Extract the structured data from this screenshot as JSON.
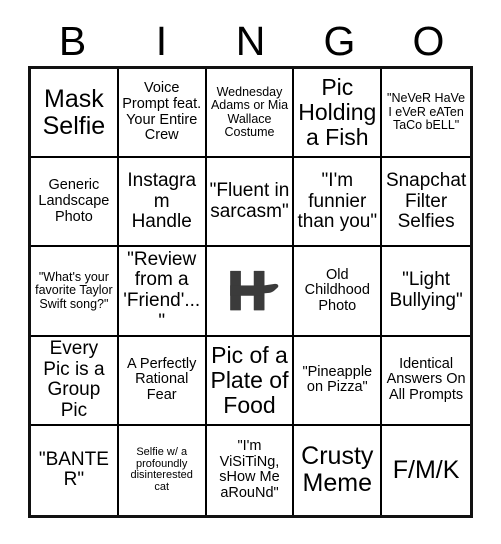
{
  "card": {
    "header_letters": [
      "B",
      "I",
      "N",
      "G",
      "O"
    ],
    "rows": [
      [
        {
          "text": "Mask Selfie",
          "size": "xl"
        },
        {
          "text": "Voice Prompt feat. Your Entire Crew",
          "size": "sm"
        },
        {
          "text": "Wednesday Adams or Mia Wallace Costume",
          "size": "xs"
        },
        {
          "text": "Pic Holding a Fish",
          "size": "lg"
        },
        {
          "text": "\"NeVeR HaVe I eVeR eATen TaCo bELL\"",
          "size": "xs"
        }
      ],
      [
        {
          "text": "Generic Landscape Photo",
          "size": "sm"
        },
        {
          "text": "Instagram Handle",
          "size": "md"
        },
        {
          "text": "\"Fluent in sarcasm\"",
          "size": "md"
        },
        {
          "text": "\"I'm funnier than you\"",
          "size": "md"
        },
        {
          "text": "Snapchat Filter Selfies",
          "size": "md"
        }
      ],
      [
        {
          "text": "\"What's your favorite Taylor Swift song?\"",
          "size": "xs"
        },
        {
          "text": "\"Review from a 'Friend'...\"",
          "size": "md"
        },
        {
          "text": "",
          "size": "md",
          "free_space": true,
          "logo": "h-swoosh-logo"
        },
        {
          "text": "Old Childhood Photo",
          "size": "sm"
        },
        {
          "text": "\"Light Bullying\"",
          "size": "md"
        }
      ],
      [
        {
          "text": "Every Pic is a Group Pic",
          "size": "md"
        },
        {
          "text": "A Perfectly Rational Fear",
          "size": "sm"
        },
        {
          "text": "Pic of a Plate of Food",
          "size": "lg"
        },
        {
          "text": "\"Pineapple on Pizza\"",
          "size": "sm"
        },
        {
          "text": "Identical Answers On All Prompts",
          "size": "sm"
        }
      ],
      [
        {
          "text": "\"BANTER\"",
          "size": "md"
        },
        {
          "text": "Selfie w/ a profoundly disinterested cat",
          "size": "xxs"
        },
        {
          "text": "\"I'm ViSiTiNg, sHow Me aRouNd\"",
          "size": "sm"
        },
        {
          "text": "Crusty Meme",
          "size": "xl"
        },
        {
          "text": "F/M/K",
          "size": "xl"
        }
      ]
    ],
    "colors": {
      "background": "#ffffff",
      "grid_line": "#000000",
      "grid_border": "#111111",
      "text": "#000000",
      "logo": "#3b3b3b"
    }
  }
}
